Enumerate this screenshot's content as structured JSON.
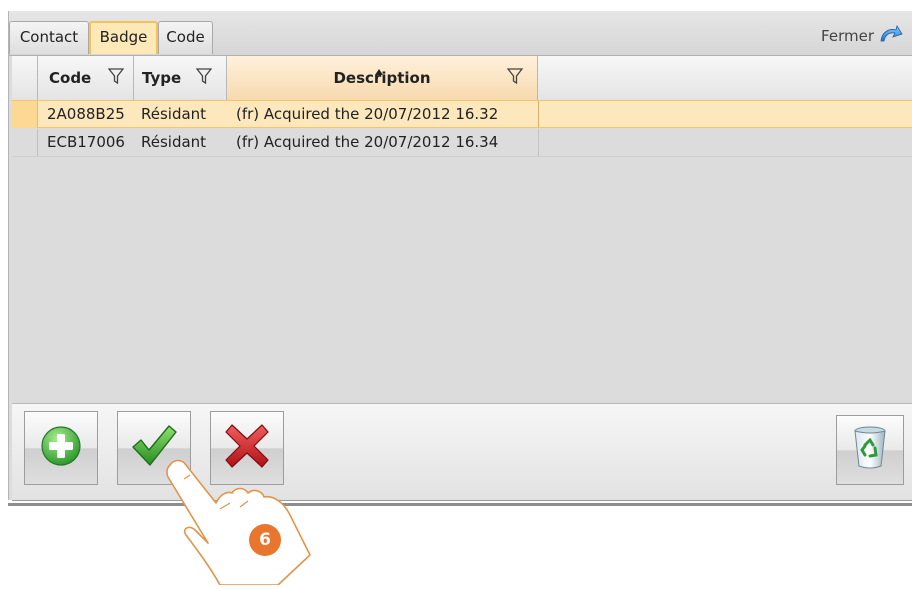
{
  "tabs": [
    {
      "label": "Contact",
      "active": false
    },
    {
      "label": "Badge",
      "active": true
    },
    {
      "label": "Code",
      "active": false
    }
  ],
  "close_label": "Fermer",
  "columns": {
    "code": "Code",
    "type": "Type",
    "description": "Description"
  },
  "rows": [
    {
      "code": "2A088B25",
      "type": "Résidant",
      "description": "(fr) Acquired the 20/07/2012 16.32",
      "selected": true
    },
    {
      "code": "ECB17006",
      "type": "Résidant",
      "description": "(fr) Acquired the 20/07/2012 16.34",
      "selected": false
    }
  ],
  "step_badge": "6",
  "colors": {
    "accent": "#f3c25c",
    "selected_row": "#fde8bd",
    "badge": "#e8762d",
    "add_green": "#3aa53a",
    "confirm_green": "#2e9b2e",
    "cancel_red": "#c8181e"
  },
  "icons": {
    "add": "plus-circle-icon",
    "confirm": "checkmark-icon",
    "cancel": "cross-icon",
    "delete": "recycle-bin-icon",
    "close": "close-arrow-icon",
    "filter": "filter-funnel-icon"
  }
}
